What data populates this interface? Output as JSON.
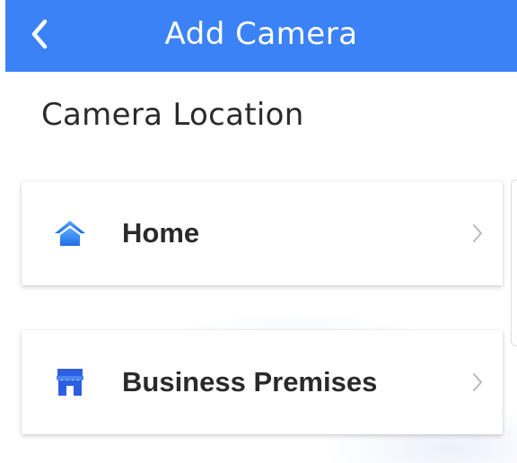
{
  "header": {
    "title": "Add Camera",
    "back_icon": "chevron-left-icon",
    "background_color": "#3b82f6"
  },
  "section": {
    "title": "Camera Location"
  },
  "locations": [
    {
      "label": "Home",
      "icon": "house-icon",
      "icon_color": "#2f80ed"
    },
    {
      "label": "Business Premises",
      "icon": "storefront-icon",
      "icon_color": "#2f5fe0"
    }
  ]
}
